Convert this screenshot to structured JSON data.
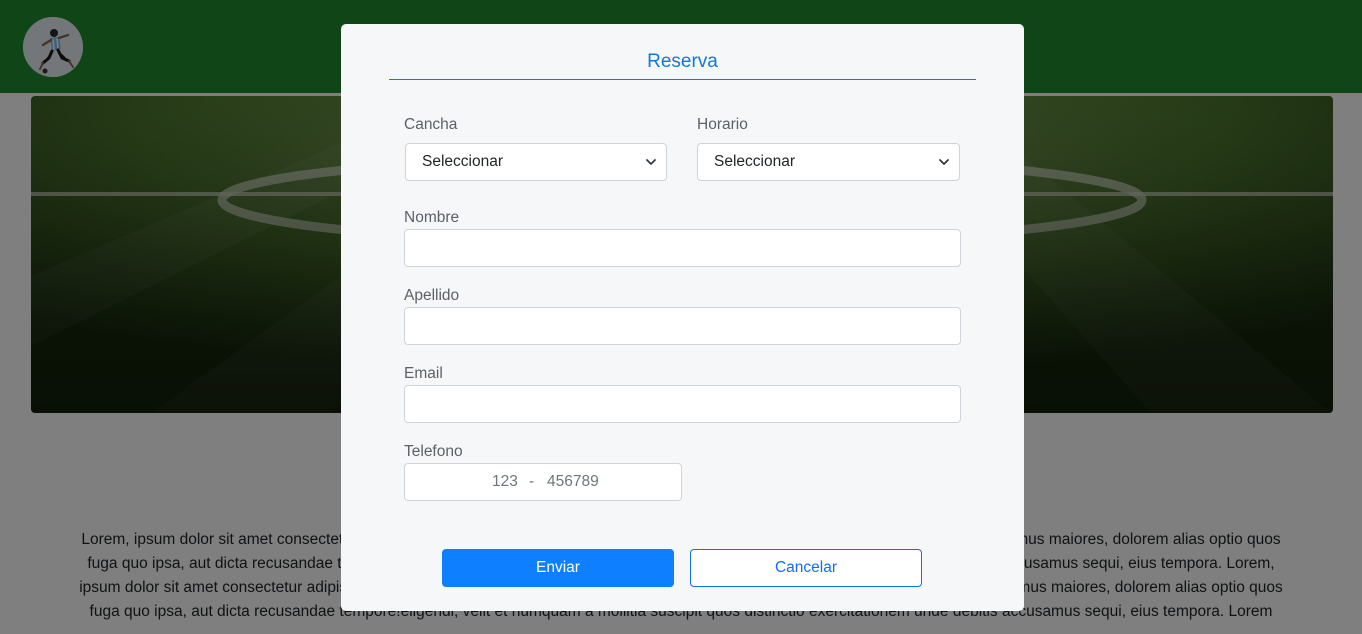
{
  "page": {
    "paragraph": "Lorem, ipsum dolor sit amet consectetur adipisicing elit. Voluptatibus ipsum facilis quae, molestias laborum distinctio, voluptatum accusamus maiores, dolorem alias optio quos fuga quo ipsa, aut dicta recusandae tempore!eligendi, velit et numquam a mollitia suscipit quos distinctio exercitationem unde debitis accusamus sequi, eius tempora. Lorem, ipsum dolor sit amet consectetur adipisicing elit. Voluptatibus ipsum facilis quae, molestias laborum distinctio, voluptatum. Labore accusamus maiores, dolorem alias optio quos fuga quo ipsa, aut dicta recusandae tempore!eligendi, velit et numquam a mollitia suscipit quos distinctio exercitationem unde debitis accusamus sequi, eius tempora. Lorem"
  },
  "modal": {
    "title": "Reserva",
    "cancha": {
      "label": "Cancha",
      "selected": "Seleccionar"
    },
    "horario": {
      "label": "Horario",
      "selected": "Seleccionar"
    },
    "nombre": {
      "label": "Nombre",
      "value": ""
    },
    "apellido": {
      "label": "Apellido",
      "value": ""
    },
    "email": {
      "label": "Email",
      "value": ""
    },
    "telefono": {
      "label": "Telefono",
      "prefix": "123",
      "separator": "-",
      "number": "456789"
    },
    "submit_label": "Enviar",
    "cancel_label": "Cancelar"
  },
  "colors": {
    "navbar": "#1f8a2e",
    "accent": "#0d7ae0",
    "primary_button": "#0d7fff",
    "modal_background": "#f6f7f9"
  },
  "icons": {
    "logo": "soccer-player-logo-icon",
    "select_arrow": "chevron-down-icon"
  }
}
